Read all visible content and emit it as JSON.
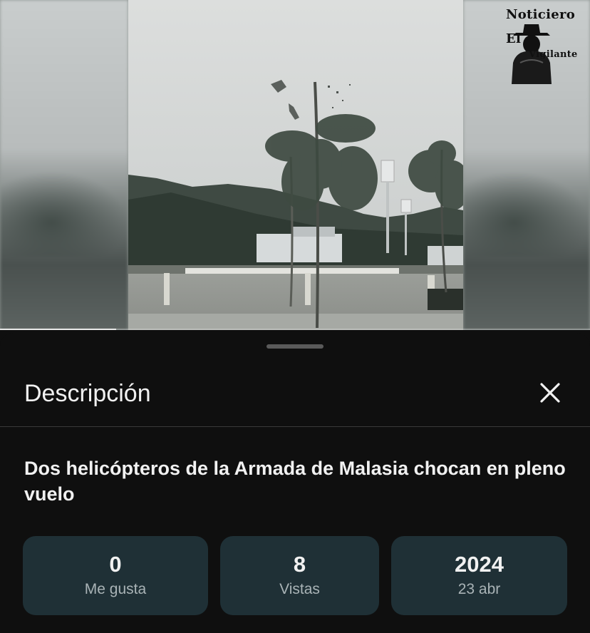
{
  "video": {
    "progress": 0.197,
    "watermark": {
      "line1": "Noticiero",
      "line2": "El",
      "line3": "Vigilante"
    }
  },
  "description_sheet": {
    "title": "Descripción",
    "close_icon": "close-icon",
    "video_title": "Dos helicópteros de la Armada de Malasia chocan en pleno vuelo",
    "stats": [
      {
        "value": "0",
        "label": "Me gusta"
      },
      {
        "value": "8",
        "label": "Vistas"
      },
      {
        "value": "2024",
        "label": "23 abr"
      }
    ]
  },
  "colors": {
    "background": "#0f0f0f",
    "stat_card": "#1f3036",
    "text_primary": "#f1f1f1",
    "text_secondary": "#a9b3b6"
  }
}
